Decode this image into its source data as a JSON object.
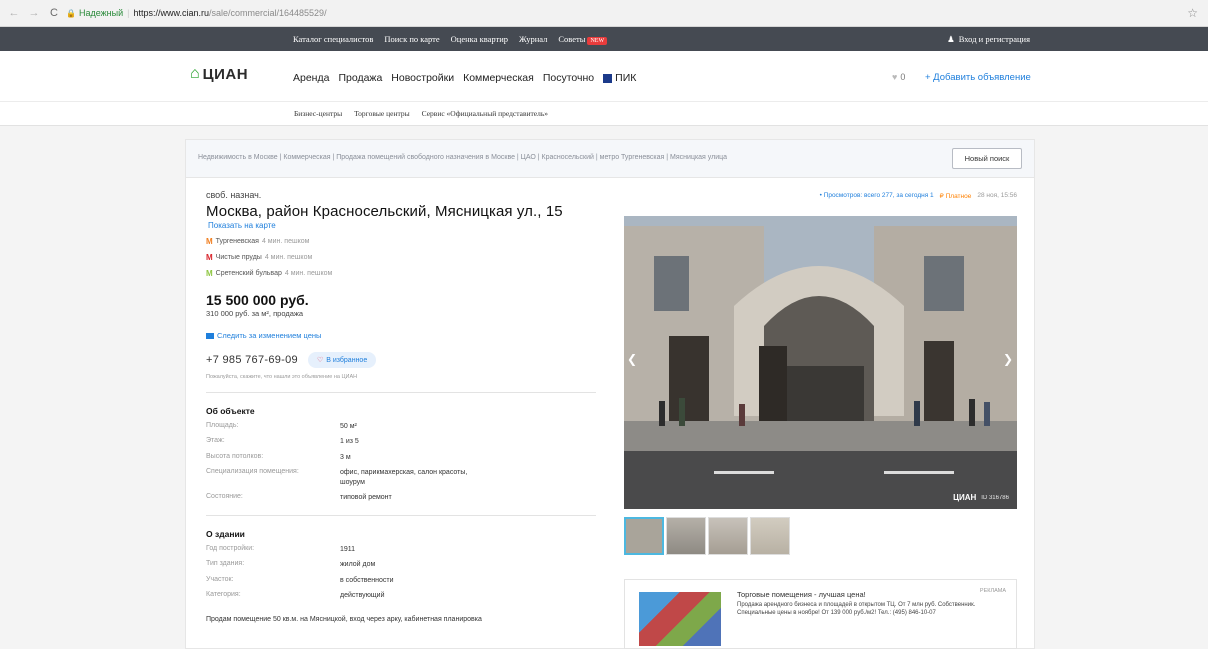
{
  "browser": {
    "secure_label": "Надежный",
    "url_host": "https://www.cian.ru",
    "url_path": "/sale/commercial/164485529/"
  },
  "topbar": {
    "links": [
      "Каталог специалистов",
      "Поиск по карте",
      "Оценка квартир",
      "Журнал",
      "Советы"
    ],
    "new_badge": "NEW",
    "login": "Вход и регистрация"
  },
  "header": {
    "logo_text": "ЦИАН",
    "nav": [
      "Аренда",
      "Продажа",
      "Новостройки",
      "Коммерческая",
      "Посуточно"
    ],
    "pik": "ПИК",
    "favorites_count": "0",
    "add_listing": "+ Добавить объявление"
  },
  "subnav": [
    "Бизнес-центры",
    "Торговые центры",
    "Сервис «Официальный представитель»"
  ],
  "breadcrumbs": "Недвижимость в Москве  |  Коммерческая  |  Продажа помещений свободного назначения в Москве  |  ЦАО  |  Красносельский  |  метро Тургеневская  |  Мясницкая улица",
  "new_search": "Новый поиск",
  "listing": {
    "category": "своб. назнач.",
    "address": "Москва, район Красносельский, Мясницкая ул., 15",
    "map_link": "Показать на карте",
    "metro": [
      {
        "name": "Тургеневская",
        "walk": "4 мин. пешком",
        "color": "#f07e1f"
      },
      {
        "name": "Чистые пруды",
        "walk": "4 мин. пешком",
        "color": "#d8232a"
      },
      {
        "name": "Сретенский бульвар",
        "walk": "4 мин. пешком",
        "color": "#8ec641"
      }
    ],
    "price": "15 500 000 руб.",
    "price_per_m": "310 000 руб. за м², продажа",
    "watch_price": "Следить за изменением цены",
    "phone": "+7 985 767-69-09",
    "favorite": "В избранное",
    "note": "Пожалуйста, скажите, что нашли это объявление на ЦИАН"
  },
  "about_object": {
    "title": "Об объекте",
    "rows": [
      {
        "k": "Площадь:",
        "v": "50 м²"
      },
      {
        "k": "Этаж:",
        "v": "1 из 5"
      },
      {
        "k": "Высота потолков:",
        "v": "3 м"
      },
      {
        "k": "Специализация помещения:",
        "v": "офис, парикмахерская, салон красоты, шоурум"
      },
      {
        "k": "Состояние:",
        "v": "типовой ремонт"
      }
    ]
  },
  "about_building": {
    "title": "О здании",
    "rows": [
      {
        "k": "Год постройки:",
        "v": "1911"
      },
      {
        "k": "Тип здания:",
        "v": "жилой дом"
      },
      {
        "k": "Участок:",
        "v": "в собственности"
      },
      {
        "k": "Категория:",
        "v": "действующий"
      }
    ]
  },
  "description": "Продам помещение 50 кв.м. на Мясницкой, вход через арку, кабинетная планировка",
  "stats": {
    "views": "• Просмотров: всего 277, за сегодня 1",
    "paid": "₽ Платное",
    "date": "28 ноя, 15:56"
  },
  "photo": {
    "watermark": "ЦИАН",
    "watermark_id": "ID 316786"
  },
  "ad": {
    "title": "Торговые помещения - лучшая цена!",
    "tag": "РЕКЛАМА",
    "text": "Продажа арендного бизнеса и площадей в открытом ТЦ. От 7 млн руб. Собственник. Специальные цены в ноябре! От 139 000 руб./м2! Тел.: (495) 846-10-07"
  }
}
